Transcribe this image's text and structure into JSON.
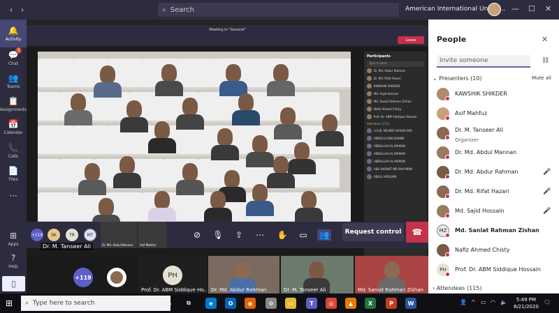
{
  "topbar": {
    "search_placeholder": "Search",
    "org_name": "American International Univer...",
    "back_icon": "‹",
    "forward_icon": "›",
    "more_label": "···",
    "minimize": "—",
    "maximize": "☐",
    "close": "✕"
  },
  "rail": {
    "items": [
      {
        "label": "Activity",
        "icon": "bell-icon",
        "glyph": "🔔"
      },
      {
        "label": "Chat",
        "icon": "chat-icon",
        "glyph": "💬",
        "badge": "3"
      },
      {
        "label": "Teams",
        "icon": "teams-icon",
        "glyph": "👥"
      },
      {
        "label": "Assignments",
        "icon": "assignments-icon",
        "glyph": "📋"
      },
      {
        "label": "Calendar",
        "icon": "calendar-icon",
        "glyph": "📅"
      },
      {
        "label": "Calls",
        "icon": "phone-icon",
        "glyph": "📞"
      },
      {
        "label": "Files",
        "icon": "files-icon",
        "glyph": "📄"
      },
      {
        "label": "",
        "icon": "more-icon",
        "glyph": "···"
      },
      {
        "label": "Apps",
        "icon": "apps-icon",
        "glyph": "⊞"
      },
      {
        "label": "Help",
        "icon": "help-icon",
        "glyph": "?"
      }
    ]
  },
  "shared_screen": {
    "window_title": "Meeting in \"General\"",
    "leave_label": "Leave",
    "participants_title": "Participants",
    "participants_search": "Type a name",
    "participants": [
      "Dr. Md. Abdur Rahman",
      "Dr. Md. Rifat Hazari",
      "KAWSHIK SHIKDER",
      "Md. Sajid Hossain",
      "Md. Saniat Rahman Zishan",
      "Nafiz Ahmed Chisty",
      "Prof. Dr. ABM Siddique Hossain"
    ],
    "attendees_header": "Attendees (115)",
    "attendees": [
      "A.S.M. MEHEDI HASAN SAD",
      "ABDULLA BIN SHAMIE",
      "ABDULLAH AL MAMUN",
      "ABDULLAH AL MAMUN",
      "ABDULLAH AL MAMUN",
      "ABU HASNAT MD RAHYMAN",
      "ABULL HOSSAIN"
    ],
    "inner_thumb_labels": [
      "Dr. Md. Abdul Mannan",
      "Asif Mahfuz"
    ],
    "inner_avatars": [
      "+119",
      "SK",
      "TR",
      "MT"
    ]
  },
  "controls": {
    "request_control_label": "Request control",
    "presenter_label": "Dr. M. Tanseer Ali",
    "icons": [
      "camera-off-icon",
      "mic-icon",
      "share-icon",
      "more-icon",
      "raise-hand-icon",
      "chat-icon",
      "participants-icon"
    ]
  },
  "strip": {
    "overflow_count": "+119",
    "ph_initials": "PH",
    "tiles": [
      {
        "label": "Prof. Dr. ABM Siddique Ho..."
      },
      {
        "label": "Dr. Md. Abdur Rahman"
      },
      {
        "label": "Dr. M. Tanseer Ali"
      },
      {
        "label": "Md. Saniat Rahman Zishan"
      }
    ]
  },
  "people": {
    "title": "People",
    "invite_placeholder": "Invite someone",
    "presenters_header": "Presenters (10)",
    "mute_all": "Mute all",
    "presenters": [
      {
        "name": "KAWSHIK SHIKDER",
        "bold": false,
        "muted": false
      },
      {
        "name": "Asif Mahfuz",
        "bold": false,
        "muted": false
      },
      {
        "name": "Dr. M. Tanseer Ali",
        "sub": "Organizer",
        "bold": false,
        "muted": false
      },
      {
        "name": "Dr. Md. Abdul Mannan",
        "bold": false,
        "muted": false
      },
      {
        "name": "Dr. Md. Abdur Rahman",
        "bold": false,
        "muted": true
      },
      {
        "name": "Dr. Md. Rifat Hazari",
        "bold": false,
        "muted": true
      },
      {
        "name": "Md. Sajid Hossain",
        "bold": false,
        "muted": true
      },
      {
        "name": "Md. Saniat Rahman Zishan",
        "bold": true,
        "muted": false,
        "initials": "MZ"
      },
      {
        "name": "Nafiz Ahmed Chisty",
        "bold": false,
        "muted": false
      },
      {
        "name": "Prof. Dr. ABM Siddique Hossain",
        "bold": false,
        "muted": false,
        "initials": "PH"
      }
    ],
    "attendees_header": "Attendees (115)"
  },
  "taskbar": {
    "search_placeholder": "Type here to search",
    "time": "5:49 PM",
    "date": "8/21/2020"
  },
  "colors": {
    "teams_purple": "#464775",
    "accent": "#6264a7",
    "leave_red": "#c4314b"
  }
}
